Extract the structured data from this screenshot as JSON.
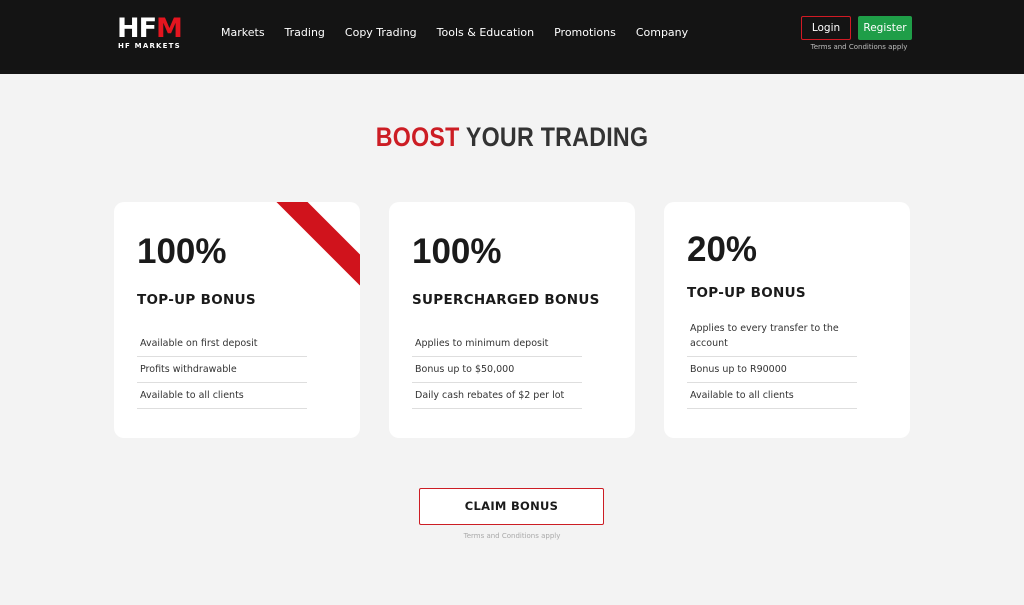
{
  "header": {
    "logo": {
      "mark_main": "HF",
      "mark_accent": "M",
      "subtitle": "HF MARKETS"
    },
    "nav": [
      "Markets",
      "Trading",
      "Copy Trading",
      "Tools & Education",
      "Promotions",
      "Company"
    ],
    "login_label": "Login",
    "register_label": "Register",
    "terms": "Terms and Conditions apply"
  },
  "main": {
    "title_accent": "BOOST",
    "title_rest": " YOUR TRADING",
    "cards": [
      {
        "percent": "100%",
        "name": "TOP-UP BONUS",
        "features": [
          "Available on first deposit",
          "Profits withdrawable",
          "Available to all clients"
        ],
        "ribbon": true
      },
      {
        "percent": "100%",
        "name": "SUPERCHARGED BONUS",
        "features": [
          "Applies to minimum deposit",
          "Bonus up to $50,000",
          "Daily cash rebates of $2 per lot"
        ]
      },
      {
        "percent": "20%",
        "name": "TOP-UP BONUS",
        "features": [
          "Applies to every transfer to the account",
          "Bonus up to R90000",
          "Available to all clients"
        ]
      }
    ],
    "claim_label": "CLAIM BONUS",
    "claim_terms": "Terms and Conditions apply"
  },
  "colors": {
    "header_bg": "#141414",
    "page_bg": "#f3f3f3",
    "accent_red": "#cc1d24",
    "register_green": "#1f9e48"
  }
}
